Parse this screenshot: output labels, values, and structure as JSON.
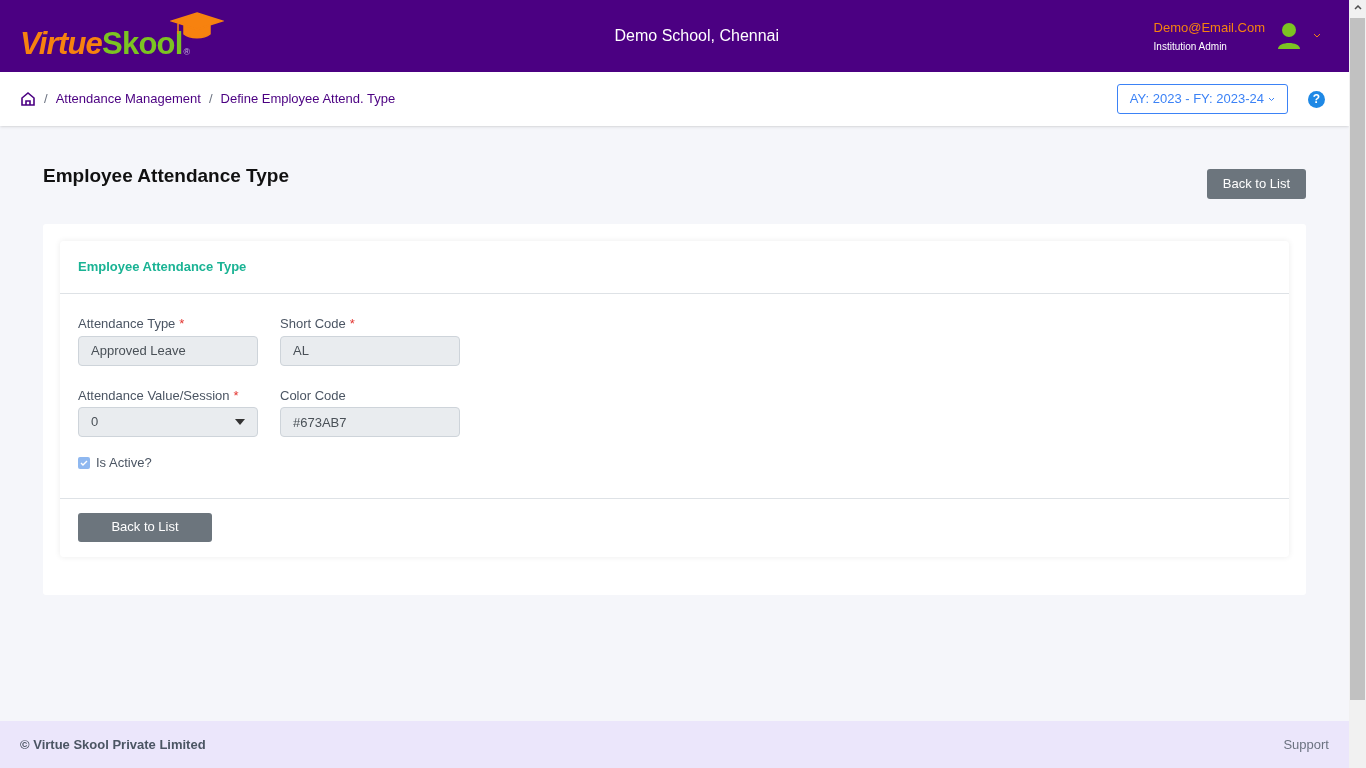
{
  "header": {
    "logo": {
      "part_1": "Virtue",
      "part_2": "Skool",
      "mark": "®"
    },
    "school": "Demo School, Chennai",
    "user": {
      "email": "Demo@Email.Com",
      "role": "Institution Admin"
    }
  },
  "breadcrumb": [
    {
      "separator": "/",
      "label": "Attendance Management"
    },
    {
      "separator": "/",
      "label": "Define Employee Attend. Type"
    }
  ],
  "year_selector": "AY: 2023 - FY: 2023-24",
  "help": "?",
  "page_title": "Employee Attendance Type",
  "top_button": "Back to List",
  "card": {
    "title": "Employee Attendance Type",
    "rows": [
      [
        {
          "label": "Attendance Type",
          "required_mark": "*",
          "value": "Approved Leave",
          "kind": "text",
          "disabled": true
        },
        {
          "label": "Short Code",
          "required_mark": "*",
          "value": "AL",
          "kind": "text",
          "disabled": true
        }
      ],
      [
        {
          "label": "Attendance Value/Session",
          "required_mark": "*",
          "value": "0",
          "kind": "select",
          "disabled": true
        },
        {
          "label": "Color Code",
          "value": "#673AB7",
          "kind": "text",
          "disabled": true
        }
      ]
    ],
    "checkbox": {
      "label": "Is Active?",
      "checked": true,
      "disabled": true
    },
    "button": "Back to List"
  },
  "footer": {
    "copyright": "© Virtue Skool Private Limited",
    "support": "Support"
  }
}
